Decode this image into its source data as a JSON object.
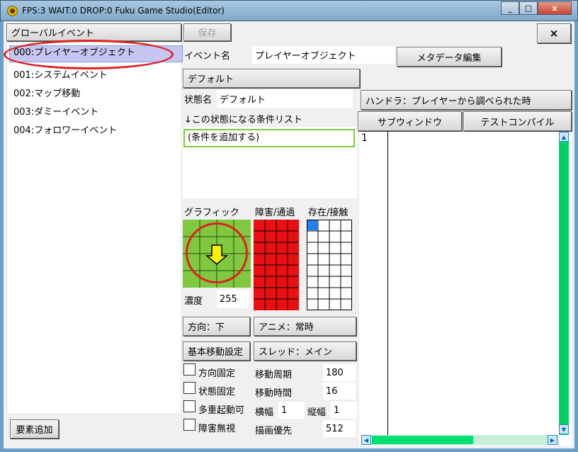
{
  "window": {
    "title": "FPS:3 WAIT:0 DROP:0 Fuku Game Studio(Editor)",
    "controls": [
      "_",
      "□",
      "x"
    ]
  },
  "left_panel": {
    "header_button": "グローバルイベント",
    "items": [
      {
        "label": "000:プレイヤーオブジェクト",
        "selected": true
      },
      {
        "label": "001:システムイベント"
      },
      {
        "label": "002:マップ移動"
      },
      {
        "label": "003:ダミーイベント"
      },
      {
        "label": "004:フォロワーイベント"
      }
    ],
    "add_button": "要素追加"
  },
  "toolbar": {
    "save_label": "保存",
    "close_label": "×"
  },
  "event": {
    "name_label": "イベント名",
    "name_value": "プレイヤーオブジェクト",
    "metadata_button": "メタデータ編集",
    "state_button": "デフォルト",
    "state_name_label": "状態名",
    "state_name_value": "デフォルト",
    "condition_header": "↓この状態になる条件リスト",
    "condition_item": "(条件を追加する)",
    "graphic_label": "グラフィック",
    "obstacle_label": "障害/通過",
    "presence_label": "存在/接触",
    "density_label": "濃度",
    "density_value": "255",
    "direction_button": "方向：下",
    "anime_button": "アニメ：常時",
    "movement_button": "基本移動設定",
    "thread_button": "スレッド：メイン",
    "checkboxes": [
      "方向固定",
      "状態固定",
      "多重起動可",
      "障害無視"
    ],
    "move_period_label": "移動周期",
    "move_period_value": "180",
    "move_time_label": "移動時間",
    "move_time_value": "16",
    "width_label": "横幅",
    "width_value": "1",
    "height_label": "縦幅",
    "height_value": "1",
    "draw_priority_label": "描画優先",
    "draw_priority_value": "512"
  },
  "handler": {
    "handler_button": "ハンドラ：プレイヤーから調べられた時",
    "subwindow_button": "サブウィンドウ",
    "test_compile_button": "テストコンパイル",
    "line_number": "1"
  },
  "colors": {
    "graphic_bg": "#80c840",
    "obstacle": "#e81010",
    "presence_marker": "#2080f0",
    "arrow": "#f8f000",
    "scrollbar": "#00e070"
  }
}
